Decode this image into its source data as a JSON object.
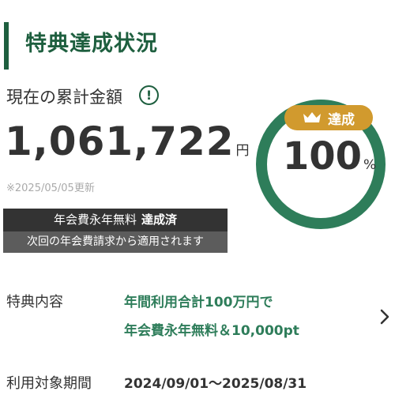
{
  "section": {
    "title": "特典達成状況"
  },
  "amount": {
    "label": "現在の累計金額",
    "info_icon": "exclamation-circle-icon",
    "value": "1,061,722",
    "unit": "円",
    "update_note": "※2025/05/05更新"
  },
  "progress": {
    "badge_label": "達成",
    "badge_icon": "crown-icon",
    "value": "100",
    "unit": "%",
    "fraction": 1.0
  },
  "status": {
    "headline": "年会費永年無料",
    "headline_strong": "達成済",
    "note": "次回の年会費請求から適用されます"
  },
  "benefit": {
    "label": "特典内容",
    "line1": "年間利用合計100万円で",
    "line2": "年会費永年無料＆10,000pt"
  },
  "period": {
    "label": "利用対象期間",
    "value": "2024/09/01〜2025/08/31"
  },
  "colors": {
    "brand_green": "#1e5f3f",
    "ring_green": "#2e7d5a",
    "badge_gold": "#d19a2e",
    "status_dark": "#333333",
    "status_gray": "#5c5c5c"
  }
}
